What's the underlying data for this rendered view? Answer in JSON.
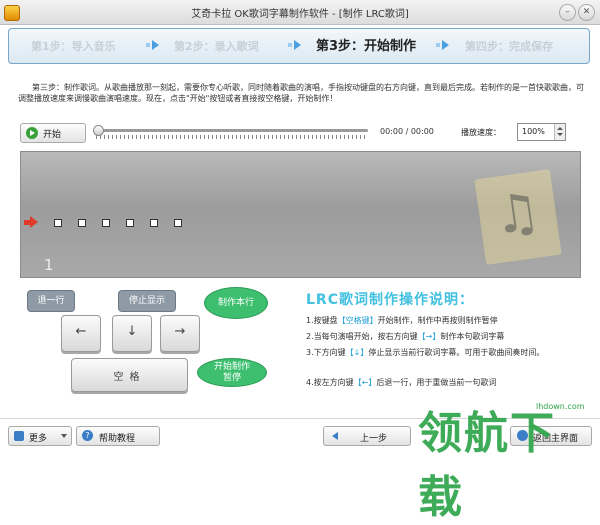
{
  "window": {
    "title": "艾奇卡拉 OK歌词字幕制作软件 - [制作 LRC歌词]",
    "minimize_glyph": "–",
    "close_glyph": "✕"
  },
  "steps": [
    {
      "label": "第1步：导入音乐"
    },
    {
      "label": "第2步：录入歌词"
    },
    {
      "label": "第3步：开始制作"
    },
    {
      "label": "第四步：完成保存"
    }
  ],
  "description": "第三步：制作歌词。从歌曲播放那一刻起，需要你专心听歌，同时随着歌曲的演唱，手指按动键盘的右方向键，直到最后完成。若制作的是一首快歌歌曲，可调整播放速度来调慢歌曲演唱速度。现在，点击\"开始\"按钮或者直接按空格键，开始制作！",
  "player": {
    "start_label": "开始",
    "time": "00:00 / 00:00",
    "speed_label": "播放速度：",
    "speed_value": "100%",
    "progress": 0
  },
  "lyric_panel": {
    "line_number": "1",
    "dots": 6
  },
  "keyboard": {
    "prev_line": "退一行",
    "stop_display": "停止显示",
    "make_line": "制作本行",
    "start_pause_1": "开始制作",
    "start_pause_2": "暂停",
    "left_key": "←",
    "down_key": "↓",
    "right_key": "→",
    "space_key": "空格"
  },
  "instructions": {
    "title": "LRC歌词制作操作说明：",
    "items": [
      {
        "pre": "1.按键盘",
        "key": "【空格键】",
        "post": "开始制作，制作中再按则制作暂停"
      },
      {
        "pre": "2.当每句演唱开始，按右方向键",
        "key": "【→】",
        "post": "制作本句歌词字幕"
      },
      {
        "pre": "3.下方向键",
        "key": "【↓】",
        "post": "停止显示当前行歌词字幕。可用于歌曲间奏时间。"
      },
      {
        "pre": "4.按左方向键",
        "key": "【←】",
        "post": "后退一行，用于重做当前一句歌词"
      }
    ]
  },
  "bottom": {
    "more_label": "更多",
    "help_label": "帮助教程",
    "prev_label": "上一步",
    "home_label": "返回主界面"
  },
  "watermark": {
    "text": "领航下载",
    "url": "lhdown.com"
  },
  "colors": {
    "accent": "#41c0e0",
    "highlight_key": "#23a0d8",
    "green_bubble": "#3dbf6f",
    "red_marker": "#e03b2a"
  }
}
